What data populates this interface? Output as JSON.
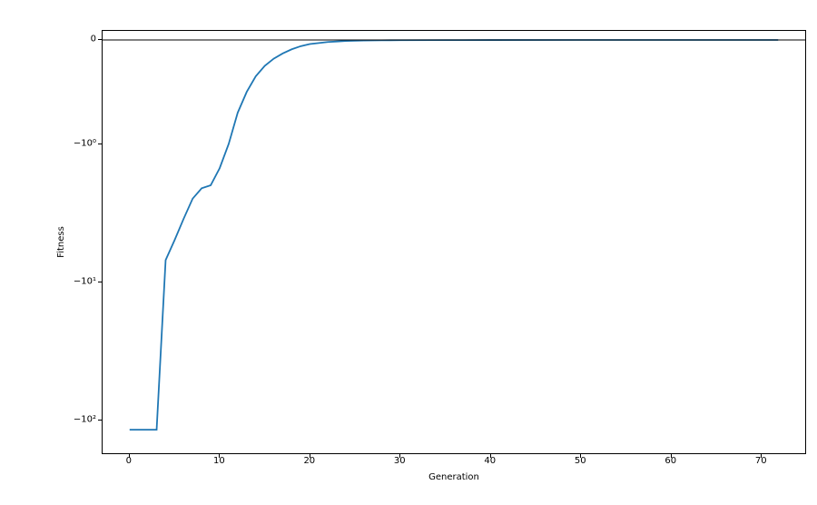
{
  "chart_data": {
    "type": "line",
    "xlabel": "Generation",
    "ylabel": "Fitness",
    "title": "",
    "xlim": [
      -3,
      75
    ],
    "y_scale": "symlog_negative",
    "y_ticks": [
      {
        "label": "0",
        "value": 0
      },
      {
        "label": "−10⁰",
        "value": -1
      },
      {
        "label": "−10¹",
        "value": -10
      },
      {
        "label": "−10²",
        "value": -100
      }
    ],
    "x_ticks": [
      0,
      10,
      20,
      30,
      40,
      50,
      60,
      70
    ],
    "series": [
      {
        "name": "fitness",
        "color": "#1f77b4",
        "x": [
          0,
          1,
          2,
          3,
          4,
          5,
          6,
          7,
          8,
          9,
          10,
          11,
          12,
          13,
          14,
          15,
          16,
          17,
          18,
          19,
          20,
          21,
          22,
          23,
          24,
          25,
          26,
          27,
          28,
          29,
          30,
          35,
          40,
          50,
          60,
          72
        ],
        "y": [
          -120,
          -120,
          -120,
          -120,
          -7,
          -5,
          -3.5,
          -2.5,
          -2.1,
          -2.0,
          -1.5,
          -1.0,
          -0.7,
          -0.5,
          -0.35,
          -0.25,
          -0.18,
          -0.13,
          -0.09,
          -0.06,
          -0.04,
          -0.03,
          -0.02,
          -0.015,
          -0.01,
          -0.008,
          -0.006,
          -0.005,
          -0.004,
          -0.003,
          -0.0025,
          -0.0015,
          -0.001,
          -0.0005,
          -0.0003,
          -0.0001
        ]
      }
    ]
  }
}
